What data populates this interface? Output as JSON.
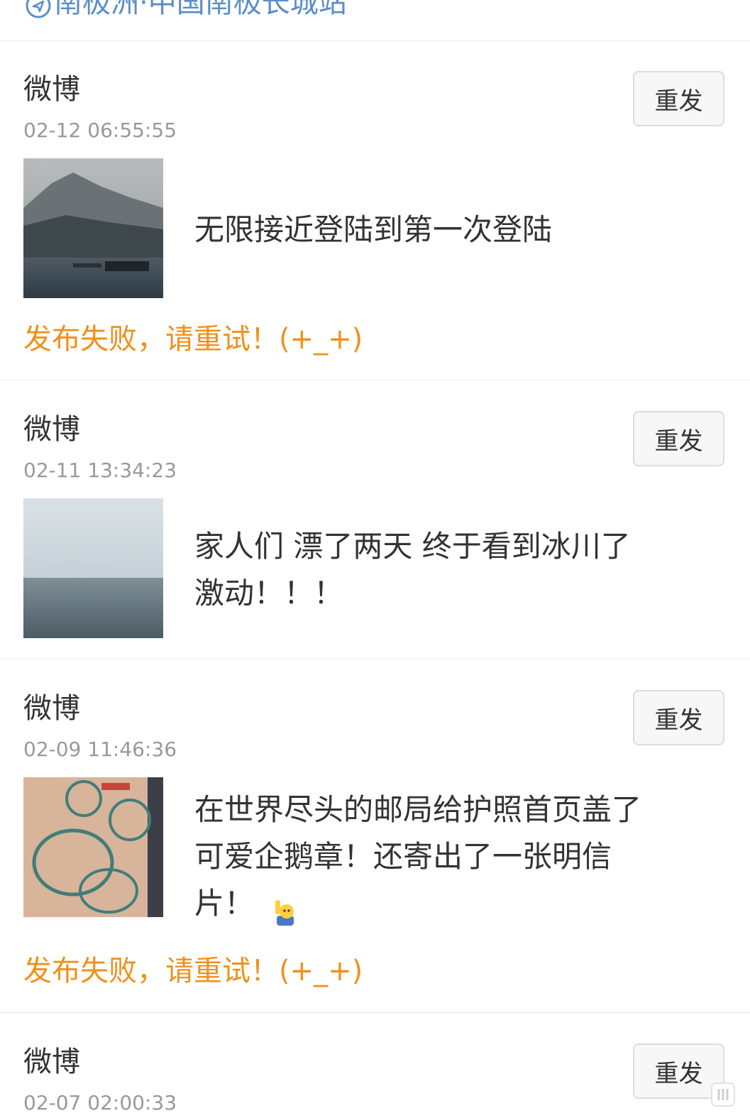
{
  "location": {
    "icon": "location-icon",
    "text": "南极洲·中国南极长城站"
  },
  "posts": [
    {
      "source": "微博",
      "time": "02-12 06:55:55",
      "resend_label": "重发",
      "content": "无限接近登陆到第一次登陆",
      "error": "发布失败，请重试！(+_+)"
    },
    {
      "source": "微博",
      "time": "02-11 13:34:23",
      "resend_label": "重发",
      "content_line1": "家人们 漂了两天 终于看到冰川了",
      "content_line2": "激动！！！"
    },
    {
      "source": "微博",
      "time": "02-09 11:46:36",
      "resend_label": "重发",
      "content_line1": "在世界尽头的邮局给护照首页盖了",
      "content_line2": "可爱企鹅章！还寄出了一张明信",
      "content_line3": "片！",
      "emoji": "raising-hand-emoji",
      "error": "发布失败，请重试！(+_+)"
    },
    {
      "source": "微博",
      "time": "02-07 02:00:33",
      "resend_label": "重发"
    }
  ],
  "colors": {
    "link_blue": "#5b8ec8",
    "error_orange": "#f0901a",
    "time_gray": "#999999",
    "divider": "#ececec"
  }
}
